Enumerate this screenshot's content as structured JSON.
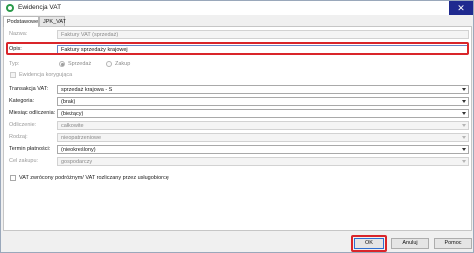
{
  "window": {
    "title": "Ewidencja VAT",
    "close_glyph": "✕"
  },
  "tabs": [
    {
      "label": "Podstawowe"
    },
    {
      "label": "JPK_VAT"
    }
  ],
  "form": {
    "nazwa": {
      "label": "Nazwa:",
      "value": "Faktury VAT (sprzedaż)"
    },
    "opis": {
      "label": "Opis:",
      "value": "Faktury sprzedaży krajowej"
    },
    "typ": {
      "label": "Typ:",
      "options": [
        "Sprzedaż",
        "Zakup"
      ],
      "selected": "Sprzedaż"
    },
    "korygujaca": {
      "label": "Ewidencja korygująca",
      "checked": false
    },
    "transakcja": {
      "label": "Transakcja VAT:",
      "value": "sprzedaż krajowa - S"
    },
    "kategoria": {
      "label": "Kategoria:",
      "value": "(brak)"
    },
    "miesiac": {
      "label": "Miesiąc odliczenia:",
      "value": "(bieżący)"
    },
    "odliczenie": {
      "label": "Odliczenie:",
      "value": "całkowite"
    },
    "rodzaj": {
      "label": "Rodzaj:",
      "value": "nieopatrzeniowe"
    },
    "termin": {
      "label": "Termin płatności:",
      "value": "(nieokreślony)"
    },
    "cel_zakupu": {
      "label": "Cel zakupu:",
      "value": "gospodarczy"
    },
    "vat_zwrocony": {
      "label": "VAT zwrócony podróżnym/ VAT rozliczany przez usługobiorcę",
      "checked": false
    }
  },
  "buttons": {
    "ok": "OK",
    "cancel": "Anuluj",
    "help": "Pomoc"
  },
  "colors": {
    "highlight": "#d9252a",
    "close_button": "#1f2a8f",
    "app_icon": "#2a9a4a"
  },
  "icons": {
    "app": "app-logo-icon",
    "close": "close-icon",
    "dropdown": "chevron-down-icon"
  }
}
